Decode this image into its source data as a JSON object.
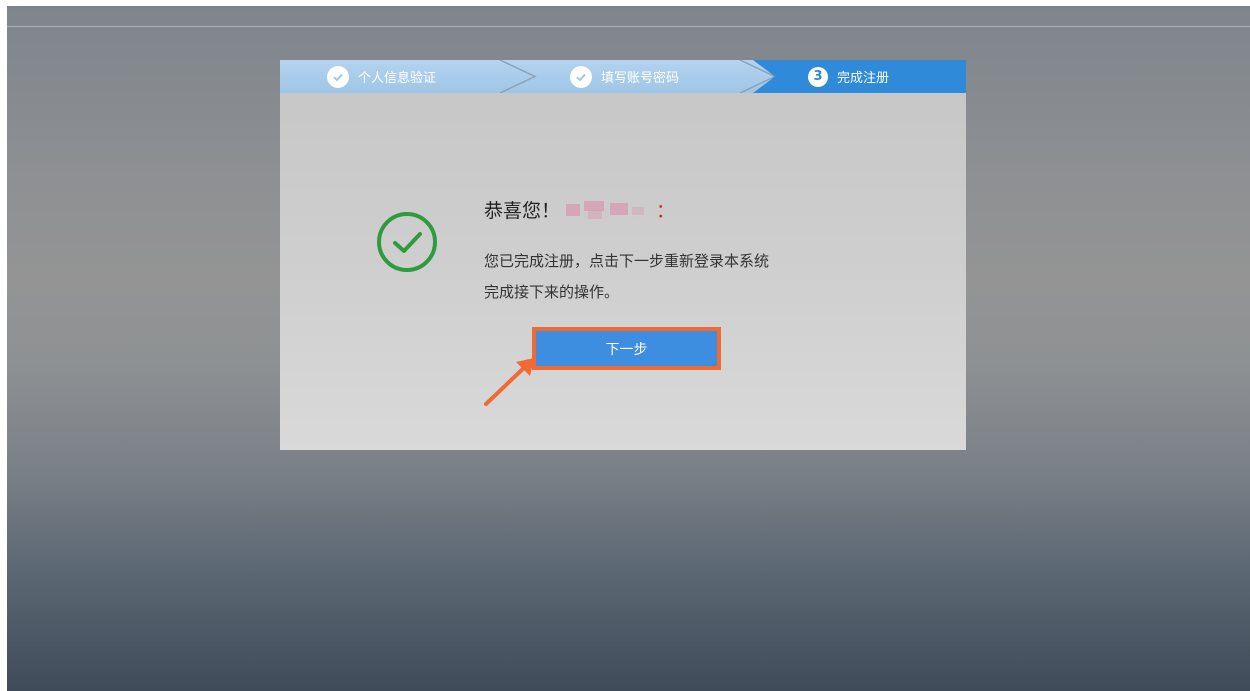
{
  "app": {
    "title": ""
  },
  "steps": [
    {
      "label": "个人信息验证",
      "status": "done",
      "icon": "check-icon"
    },
    {
      "label": "填写账号密码",
      "status": "done",
      "icon": "check-icon"
    },
    {
      "label": "完成注册",
      "number": "3",
      "status": "active"
    }
  ],
  "content": {
    "greeting": "恭喜您！",
    "colon": "：",
    "message_line1": "您已完成注册，点击下一步重新登录本系统",
    "message_line2": "完成接下来的操作。",
    "next_button_label": "下一步",
    "success_icon": "circle-check-icon"
  },
  "colors": {
    "accent": "#2f8ad9",
    "success": "#2e9b3e",
    "highlight": "#f06a34"
  }
}
